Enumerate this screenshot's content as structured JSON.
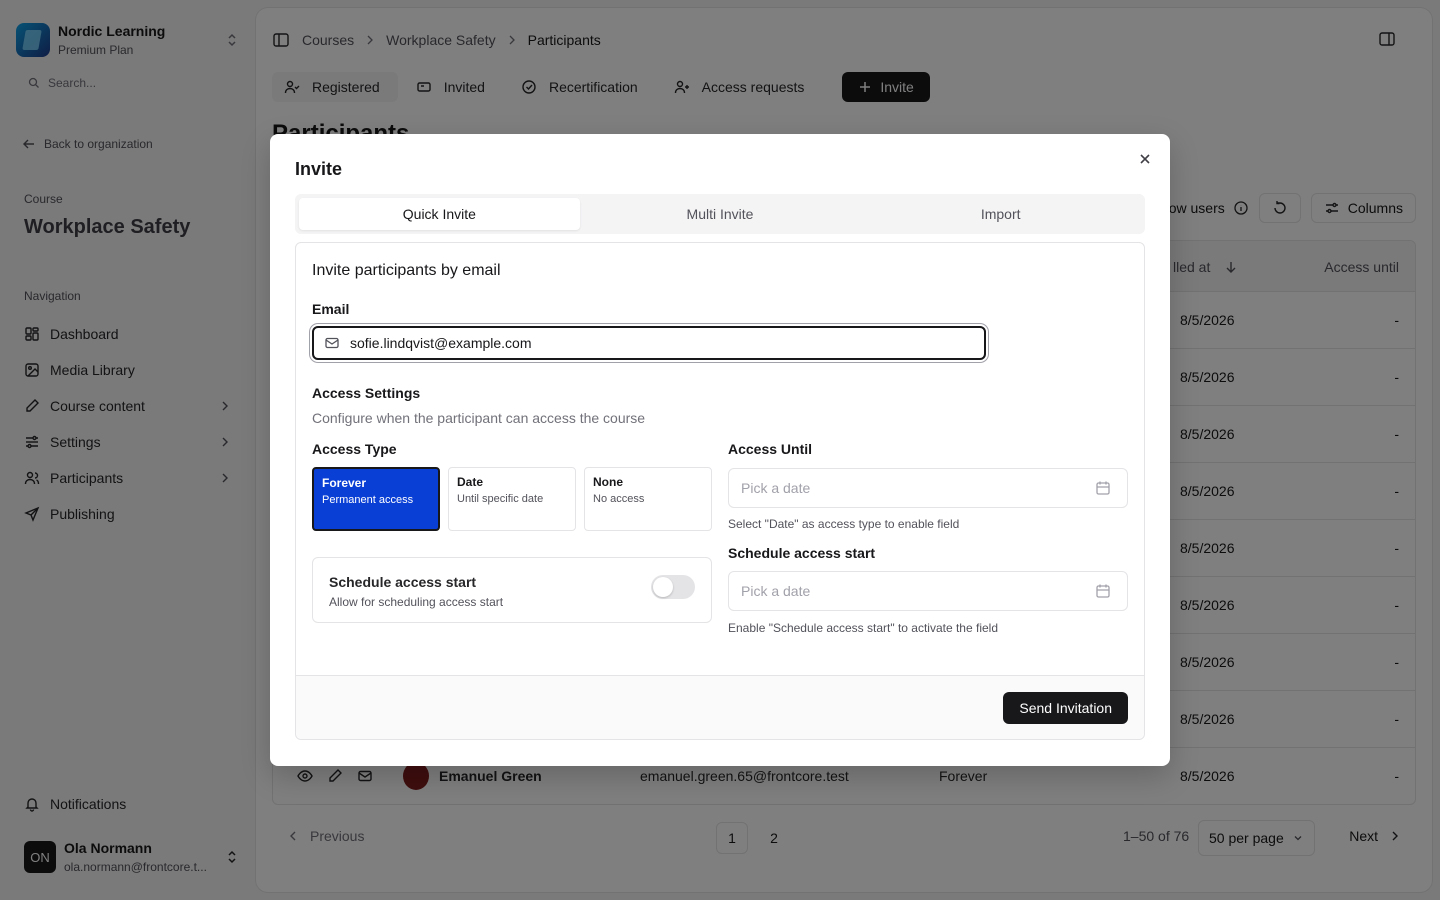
{
  "org": {
    "name": "Nordic Learning",
    "plan": "Premium Plan"
  },
  "sidebar": {
    "search_placeholder": "Search...",
    "back": "Back to organization",
    "course_caption": "Course",
    "course_title": "Workplace Safety",
    "nav_caption": "Navigation",
    "items": [
      {
        "label": "Dashboard",
        "icon": "dashboard-icon",
        "has_children": false
      },
      {
        "label": "Media Library",
        "icon": "image-icon",
        "has_children": false
      },
      {
        "label": "Course content",
        "icon": "pencil-icon",
        "has_children": true
      },
      {
        "label": "Settings",
        "icon": "sliders-icon",
        "has_children": true
      },
      {
        "label": "Participants",
        "icon": "users-icon",
        "has_children": true
      },
      {
        "label": "Publishing",
        "icon": "send-icon",
        "has_children": false
      }
    ],
    "notifications": "Notifications",
    "user": {
      "initials": "ON",
      "name": "Ola Normann",
      "email": "ola.normann@frontcore.t..."
    }
  },
  "breadcrumb": [
    "Courses",
    "Workplace Safety",
    "Participants"
  ],
  "tabs": {
    "registered": "Registered",
    "invited": "Invited",
    "recertification": "Recertification",
    "access_requests": "Access requests",
    "invite": "Invite"
  },
  "page_title": "Participants",
  "tools": {
    "show_users": "ow users",
    "columns": "Columns"
  },
  "table": {
    "col_enrolled": "lled at",
    "col_until": "Access until",
    "rows": [
      {
        "date": "8/5/2026",
        "until": "-"
      },
      {
        "date": "8/5/2026",
        "until": "-"
      },
      {
        "date": "8/5/2026",
        "until": "-"
      },
      {
        "date": "8/5/2026",
        "until": "-"
      },
      {
        "date": "8/5/2026",
        "until": "-"
      },
      {
        "date": "8/5/2026",
        "until": "-"
      },
      {
        "date": "8/5/2026",
        "until": "-"
      },
      {
        "date": "8/5/2026",
        "until": "-"
      }
    ],
    "last_row": {
      "name": "Emanuel Green",
      "email": "emanuel.green.65@frontcore.test",
      "access": "Forever",
      "date": "8/5/2026",
      "until": "-"
    }
  },
  "pager": {
    "previous": "Previous",
    "pages": [
      "1",
      "2"
    ],
    "range": "1–50 of 76",
    "per_page": "50  per page",
    "next": "Next"
  },
  "modal": {
    "title": "Invite",
    "tabs": [
      "Quick Invite",
      "Multi Invite",
      "Import"
    ],
    "card_title": "Invite participants by email",
    "email_label": "Email",
    "email_value": "sofie.lindqvist@example.com",
    "access_heading": "Access Settings",
    "access_sub": "Configure when the participant can access the course",
    "access_type_label": "Access Type",
    "types": [
      {
        "title": "Forever",
        "sub": "Permanent access",
        "selected": true
      },
      {
        "title": "Date",
        "sub": "Until specific date",
        "selected": false
      },
      {
        "title": "None",
        "sub": "No access",
        "selected": false
      }
    ],
    "schedule_title": "Schedule access start",
    "schedule_sub": "Allow for scheduling access start",
    "schedule_enabled": false,
    "until_label": "Access Until",
    "until_placeholder": "Pick a date",
    "until_hint": "Select \"Date\" as access type to enable field",
    "start_label": "Schedule access start",
    "start_placeholder": "Pick a date",
    "start_hint": "Enable \"Schedule access start\" to activate the field",
    "send": "Send Invitation"
  },
  "colors": {
    "accent": "#0a3fd6",
    "dark": "#18181b",
    "overlay": "rgba(0,0,0,0.5)"
  }
}
